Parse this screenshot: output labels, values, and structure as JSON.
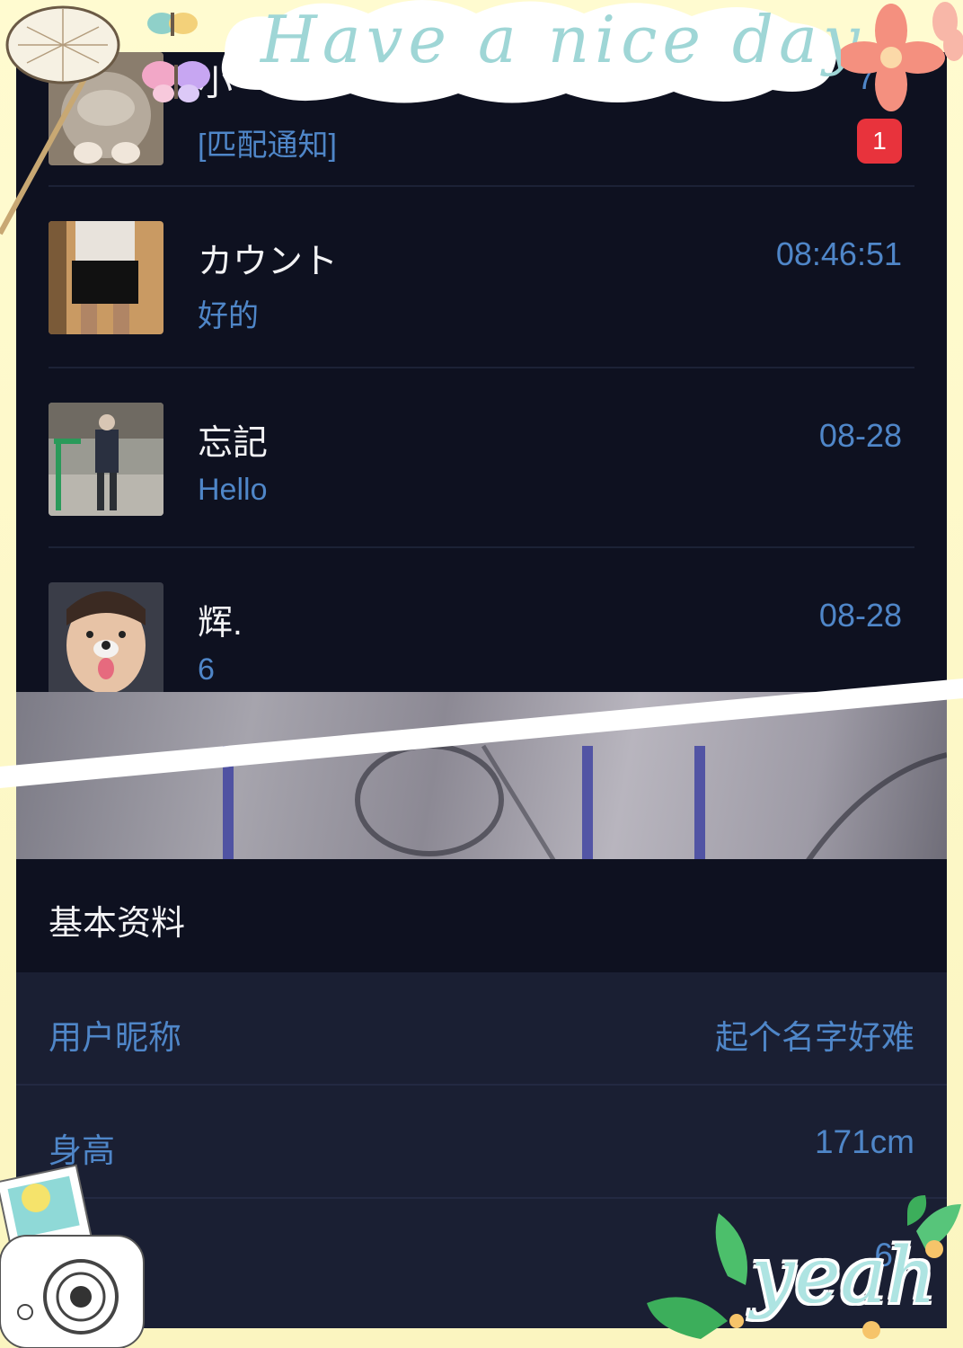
{
  "stickers": {
    "title": "Have a nice day",
    "footer": "yeah"
  },
  "chats": [
    {
      "name": "小",
      "preview": "[匹配通知]",
      "time": "7:3",
      "badge": "1",
      "avatar": "cat-avatar"
    },
    {
      "name": "カウント",
      "preview": "好的",
      "time": "08:46:51",
      "avatar": "person-standing-avatar"
    },
    {
      "name": "忘記",
      "preview": "Hello",
      "time": "08-28",
      "avatar": "person-street-avatar"
    },
    {
      "name": "辉.",
      "preview": "6",
      "time": "08-28",
      "avatar": "dog-filter-avatar"
    }
  ],
  "profile": {
    "section_title": "基本资料",
    "rows": [
      {
        "label": "用户昵称",
        "value": "起个名字好难"
      },
      {
        "label": "身高",
        "value": "171cm"
      },
      {
        "label": "",
        "value": "6"
      }
    ]
  },
  "colors": {
    "panel_bg": "#0e1120",
    "accent_blue": "#4f86c8",
    "badge_red": "#e8333c",
    "frame_yellow": "#fdf8c4"
  }
}
